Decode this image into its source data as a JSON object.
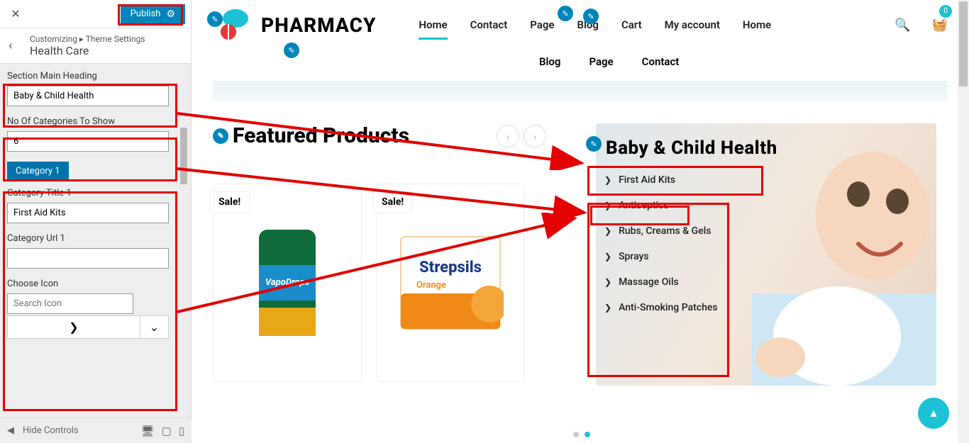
{
  "customizer": {
    "publish_label": "Publish",
    "breadcrumb_prefix": "Customizing ▸ Theme Settings",
    "breadcrumb_title": "Health Care",
    "section_heading_label": "Section Main Heading",
    "section_heading_value": "Baby & Child Health",
    "categories_count_label": "No Of Categories To Show",
    "categories_count_value": "6",
    "category_badge": "Category 1",
    "category_title_label": "Category Title 1",
    "category_title_value": "First Aid Kits",
    "category_url_label": "Category Url 1",
    "category_url_value": "",
    "choose_icon_label": "Choose Icon",
    "search_icon_placeholder": "Search Icon",
    "hide_controls": "Hide Controls"
  },
  "site": {
    "brand": "PHARMACY",
    "nav1": [
      "Home",
      "Contact",
      "Page",
      "Blog",
      "Cart",
      "My account",
      "Home"
    ],
    "nav1_active": "Home",
    "nav2": [
      "Blog",
      "Page",
      "Contact"
    ],
    "cart_count": "0"
  },
  "featured": {
    "title": "Featured Products",
    "sale_label": "Sale!",
    "product1": "VapoDrops",
    "product2_a": "Strepsils",
    "product2_b": "Orange"
  },
  "health": {
    "title": "Baby & Child Health",
    "categories": [
      "First Aid Kits",
      "Antiseptics",
      "Rubs, Creams & Gels",
      "Sprays",
      "Massage Oils",
      "Anti-Smoking Patches"
    ]
  },
  "colors": {
    "accent": "#1cc2d4",
    "publish": "#0085ba",
    "highlight": "#e20000"
  }
}
